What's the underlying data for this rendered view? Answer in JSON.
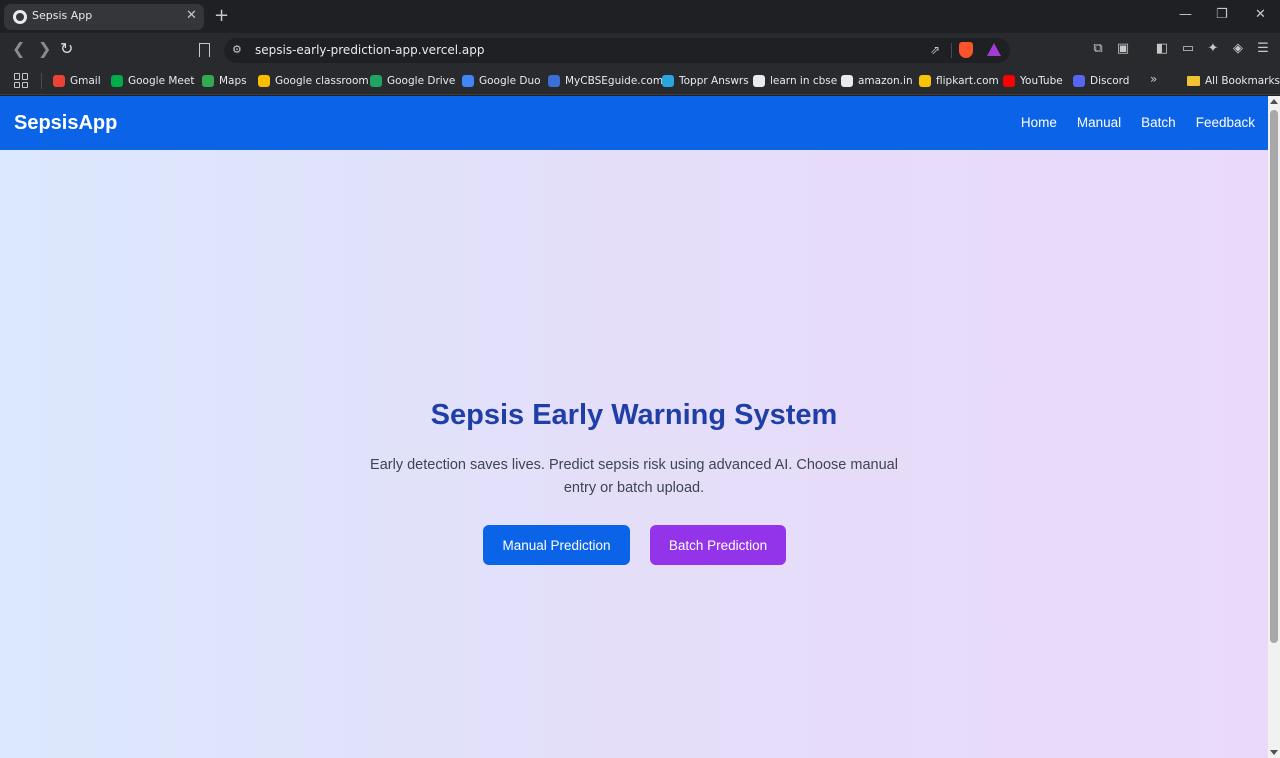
{
  "browser": {
    "tab": {
      "title": "Sepsis App",
      "close": "✕"
    },
    "new_tab": "+",
    "window_controls": {
      "minimize": "—",
      "restore": "❐",
      "close": "✕"
    },
    "nav": {
      "back": "❮",
      "forward": "❯",
      "reload": "↻"
    },
    "omnibox": {
      "url": "sepsis-early-prediction-app.vercel.app",
      "site_info": "⚙",
      "share": "⇗"
    },
    "bookmarks": [
      {
        "label": "Gmail",
        "color": "#ea4335"
      },
      {
        "label": "Google Meet",
        "color": "#00ac47"
      },
      {
        "label": "Maps",
        "color": "#34a853"
      },
      {
        "label": "Google classroom",
        "color": "#fbbc04"
      },
      {
        "label": "Google Drive",
        "color": "#1fa463"
      },
      {
        "label": "Google Duo",
        "color": "#4285f4"
      },
      {
        "label": "MyCBSEguide.com",
        "color": "#3b6fd8"
      },
      {
        "label": "Toppr Answrs",
        "color": "#2aa5e0"
      },
      {
        "label": "learn in cbse",
        "color": "#e8eaed"
      },
      {
        "label": "amazon.in",
        "color": "#e8eaed"
      },
      {
        "label": "flipkart.com",
        "color": "#f7c600"
      },
      {
        "label": "YouTube",
        "color": "#ff0000"
      },
      {
        "label": "Discord",
        "color": "#5865f2"
      }
    ],
    "bookmarks_more": "»",
    "all_bookmarks": "All Bookmarks"
  },
  "app": {
    "brand": "SepsisApp",
    "nav_links": [
      "Home",
      "Manual",
      "Batch",
      "Feedback"
    ],
    "hero": {
      "title": "Sepsis Early Warning System",
      "subtitle": "Early detection saves lives. Predict sepsis risk using advanced AI. Choose manual entry or batch upload.",
      "manual_button": "Manual Prediction",
      "batch_button": "Batch Prediction"
    },
    "colors": {
      "navbar": "#0b64e8",
      "title": "#1f3fa6",
      "manual_button": "#0b64e8",
      "batch_button": "#9333ea"
    }
  }
}
